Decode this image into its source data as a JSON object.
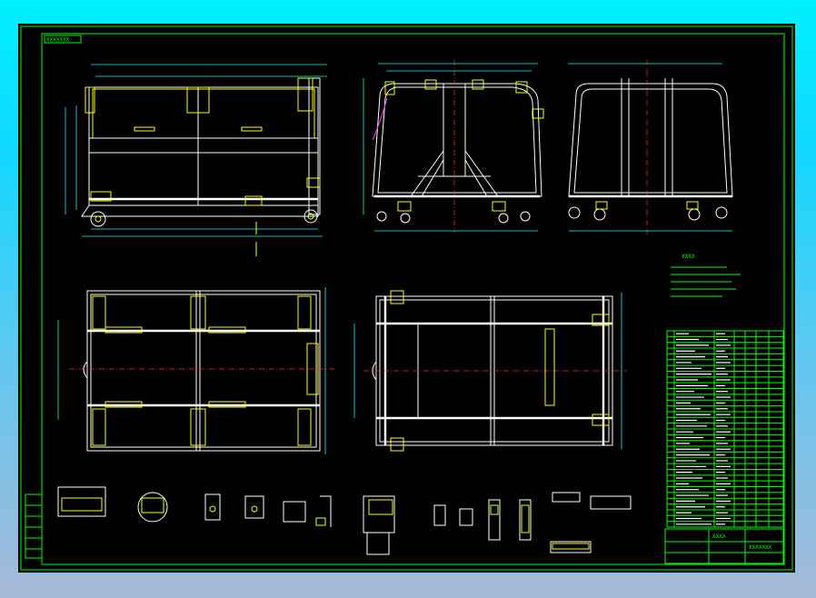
{
  "drawing": {
    "title_tag": "XXXXXXX",
    "notes_heading": "XXXX",
    "title_block_name": "XXXX",
    "title_block_code": "XXXXXXX",
    "bom_rows": 34
  },
  "colors": {
    "frame": "#00ff00",
    "outline": "#ffffff",
    "part": "#ffff00",
    "centerline": "#ff2020",
    "dimension": "#00ffff"
  }
}
